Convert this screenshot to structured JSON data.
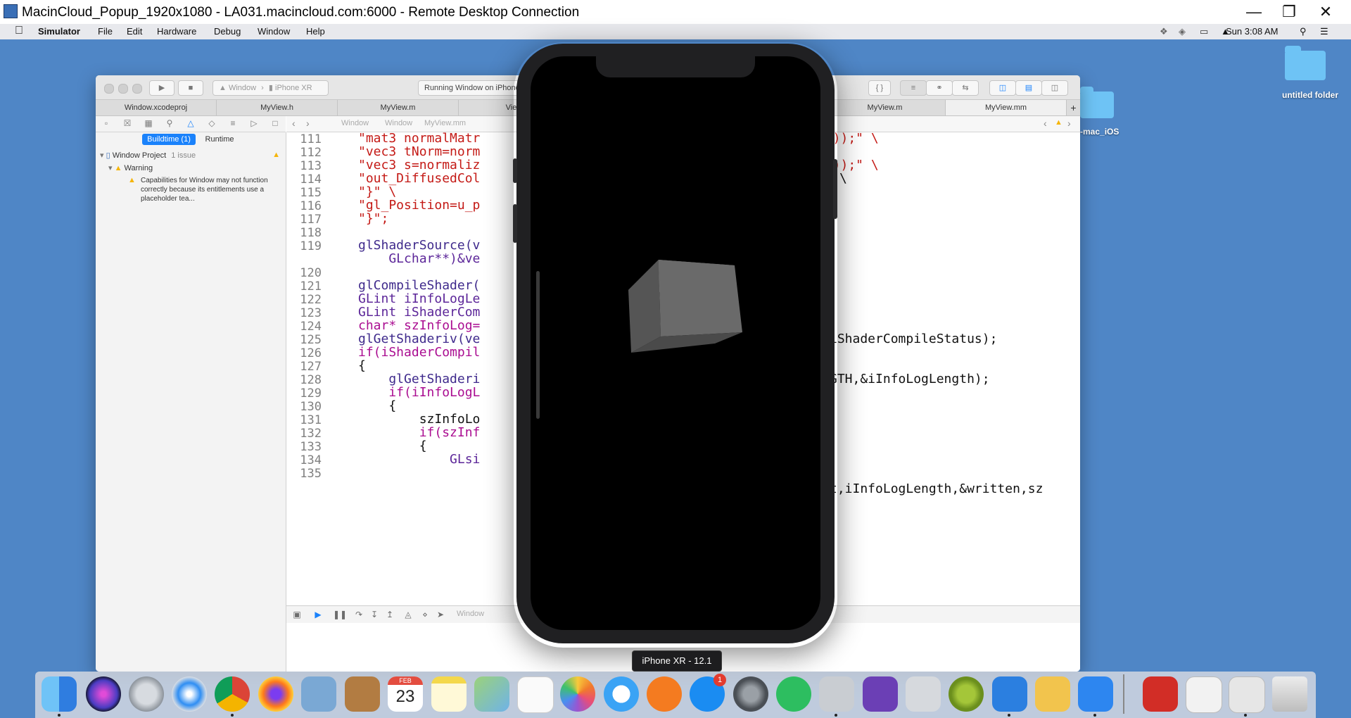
{
  "window": {
    "title": "MacinCloud_Popup_1920x1080 - LA031.macincloud.com:6000 - Remote Desktop Connection",
    "controls": [
      "—",
      "❐",
      "✕"
    ]
  },
  "menubar": {
    "apple": "",
    "items": [
      "Simulator",
      "File",
      "Edit",
      "Hardware",
      "Debug",
      "Window",
      "Help"
    ],
    "clock": "Sun 3:08 AM"
  },
  "desktop": {
    "folders": [
      {
        "label": "untitled folder"
      },
      {
        "label": "-mac_iOS"
      }
    ]
  },
  "xcode": {
    "scheme": "Window",
    "device": "iPhone XR",
    "status": "Running Window on iPhone",
    "tabs": [
      "Window.xcodeproj",
      "MyView.h",
      "MyView.m",
      "ViewCo",
      "MyView.m",
      "MyView.mm"
    ],
    "jump_bar": [
      "Window",
      "Window",
      "MyView.mm"
    ],
    "debug_path": "Window",
    "navigator": {
      "filter_buttons": [
        "Buildtime (1)",
        "Runtime"
      ],
      "project": "Window Project",
      "issue_count": "1 issue",
      "group": "Warning",
      "warning_text": "Capabilities for Window may not function correctly because its entitlements use a placeholder tea..."
    },
    "code_lines": [
      {
        "num": "111",
        "text": "\"mat3 normalMatr"
      },
      {
        "num": "112",
        "text": "\"vec3 tNorm=norm"
      },
      {
        "num": "113",
        "text": "\"vec3 s=normaliz"
      },
      {
        "num": "114",
        "text": "\"out_DiffusedCol"
      },
      {
        "num": "115",
        "text": "\"}\" \\"
      },
      {
        "num": "116",
        "text": "\"gl_Position=u_p"
      },
      {
        "num": "117",
        "text": "\"}\";"
      },
      {
        "num": "118",
        "text": ""
      },
      {
        "num": "119",
        "text": "glShaderSource(v"
      },
      {
        "num": "",
        "text": "    GLchar**)&ve"
      },
      {
        "num": "120",
        "text": ""
      },
      {
        "num": "121",
        "text": "glCompileShader("
      },
      {
        "num": "122",
        "text": "GLint iInfoLogLe"
      },
      {
        "num": "123",
        "text": "GLint iShaderCom"
      },
      {
        "num": "124",
        "text": "char* szInfoLog="
      },
      {
        "num": "125",
        "text": "glGetShaderiv(ve"
      },
      {
        "num": "126",
        "text": "if(iShaderCompil"
      },
      {
        "num": "127",
        "text": "{"
      },
      {
        "num": "128",
        "text": "    glGetShaderi"
      },
      {
        "num": "129",
        "text": "    if(iInfoLogL"
      },
      {
        "num": "130",
        "text": "    {"
      },
      {
        "num": "131",
        "text": "        szInfoLo"
      },
      {
        "num": "132",
        "text": "        if(szInf"
      },
      {
        "num": "133",
        "text": "        {"
      },
      {
        "num": "134",
        "text": "            GLsi"
      },
      {
        "num": "135",
        "text": ""
      }
    ],
    "code_right": {
      "r111": "k)));\" \\",
      "r113": "es));\" \\",
      "r114": "\\",
      "r125": "iShaderCompileStatus);",
      "r128": "GTH,&iInfoLogLength);",
      "r135": "t,iInfoLogLength,&written,sz"
    }
  },
  "simulator": {
    "label": "iPhone XR - 12.1"
  },
  "dock": {
    "calendar_month": "FEB",
    "calendar_day": "23",
    "appstore_badge": "1",
    "apps": [
      "Finder",
      "Siri",
      "Launchpad",
      "Safari",
      "Chrome",
      "Firefox",
      "Preview",
      "Contacts",
      "Calendar",
      "Notes",
      "Maps",
      "Reminders",
      "Photos",
      "Messages",
      "Books",
      "App Store",
      "System Preferences",
      "Evernote",
      "Instruments",
      "Visual Studio",
      "TextEdit",
      "Android Studio",
      "Xcode",
      "Utilities",
      "Simulator",
      "Acrobat",
      "Zip",
      "Archive Utility",
      "Trash"
    ]
  },
  "colors": {
    "desktop": "#4f86c6",
    "string": "#c41a16",
    "keyword": "#aa0d91",
    "function": "#3f2a8c",
    "warning": "#f5b50a",
    "accent": "#1a82fb"
  }
}
